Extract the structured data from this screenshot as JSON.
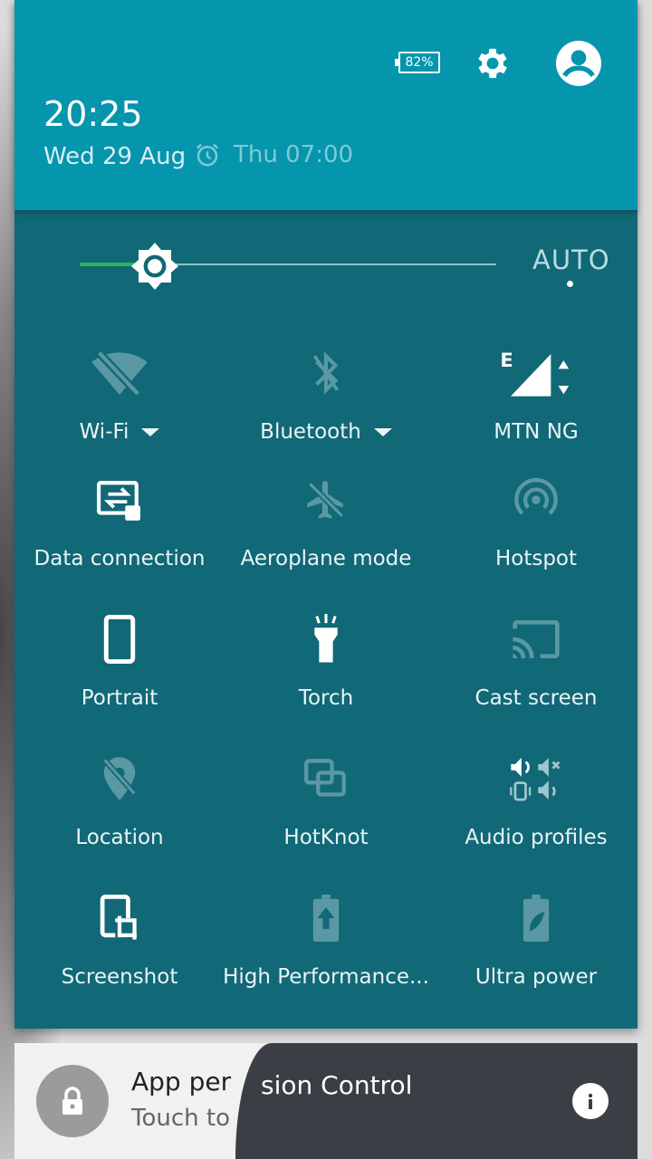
{
  "header": {
    "time": "20:25",
    "date": "Wed 29 Aug",
    "alarm": "Thu 07:00",
    "battery": "82%"
  },
  "brightness": {
    "level": 0.18,
    "auto_label": "AUTO"
  },
  "tiles": [
    {
      "label": "Wi-Fi",
      "icon": "wifi-off-icon",
      "active": false,
      "dropdown": true
    },
    {
      "label": "Bluetooth",
      "icon": "bluetooth-icon",
      "active": false,
      "dropdown": true
    },
    {
      "label": "MTN NG",
      "icon": "signal-icon",
      "active": true,
      "dropdown": false
    },
    {
      "label": "Data connection",
      "icon": "data-connection-icon",
      "active": true
    },
    {
      "label": "Aeroplane mode",
      "icon": "aeroplane-off-icon",
      "active": false
    },
    {
      "label": "Hotspot",
      "icon": "hotspot-icon",
      "active": false
    },
    {
      "label": "Portrait",
      "icon": "portrait-icon",
      "active": true
    },
    {
      "label": "Torch",
      "icon": "torch-icon",
      "active": true
    },
    {
      "label": "Cast screen",
      "icon": "cast-icon",
      "active": false
    },
    {
      "label": "Location",
      "icon": "location-off-icon",
      "active": false
    },
    {
      "label": "HotKnot",
      "icon": "hotknot-icon",
      "active": false
    },
    {
      "label": "Audio profiles",
      "icon": "audio-profiles-icon",
      "active": true
    },
    {
      "label": "Screenshot",
      "icon": "screenshot-icon",
      "active": true
    },
    {
      "label": "High Performance...",
      "icon": "battery-boost-icon",
      "active": false
    },
    {
      "label": "Ultra power",
      "icon": "battery-leaf-icon",
      "active": false
    }
  ],
  "notification": {
    "title_left": "App per",
    "title_right": "sion Control",
    "subtitle": "Touch to"
  },
  "colors": {
    "header": "#0595ad",
    "panel": "#116876",
    "slider_fill": "#27b65a"
  }
}
